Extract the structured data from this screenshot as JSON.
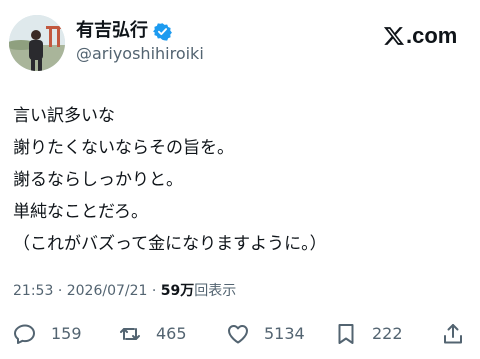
{
  "author": {
    "display_name": "有吉弘行",
    "handle": "@ariyoshihiroiki",
    "verified": true,
    "avatar": "profile-photo"
  },
  "brand": {
    "text": ".com",
    "icon": "x-logo-icon"
  },
  "tweet": {
    "lines": [
      "言い訳多いな",
      "謝りたくないならその旨を。",
      "謝るならしっかりと。",
      "単純なことだろ。",
      "（これがバズって金になりますように。）"
    ],
    "time": "21:53",
    "separator": "·",
    "date": "2026/07/21",
    "views_count": "59万",
    "views_label": "回表示"
  },
  "actions": {
    "reply": {
      "icon": "reply-icon",
      "count": "159"
    },
    "retweet": {
      "icon": "retweet-icon",
      "count": "465"
    },
    "like": {
      "icon": "heart-icon",
      "count": "5134"
    },
    "bookmark": {
      "icon": "bookmark-icon",
      "count": "222"
    },
    "share": {
      "icon": "share-icon"
    }
  },
  "colors": {
    "text": "#0f1419",
    "secondary": "#536471",
    "verified": "#1d9bf0"
  }
}
